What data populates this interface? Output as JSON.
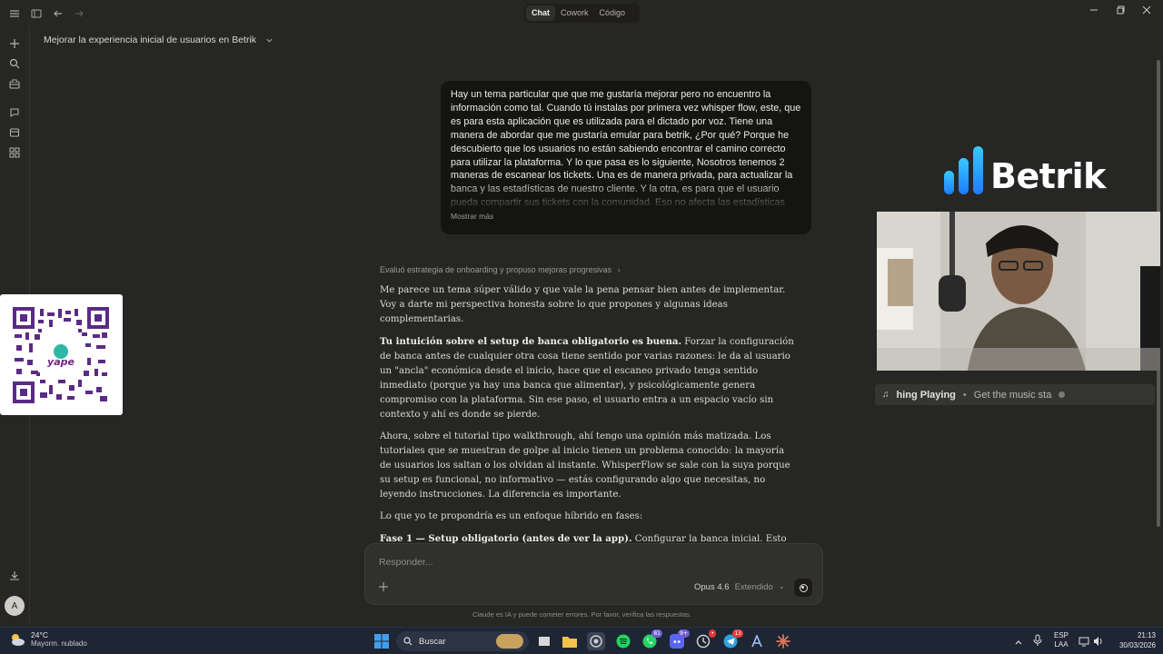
{
  "titlebar": {
    "modes": [
      "Chat",
      "Cowork",
      "Código"
    ],
    "active_mode": "Chat"
  },
  "conversation": {
    "title": "Mejorar la experiencia inicial de usuarios en Betrik"
  },
  "user_message": {
    "text": "Hay un tema particular que que me gustaría mejorar pero no encuentro la información como tal. Cuando tú instalas por primera vez whisper flow, este, que es para esta aplicación que es utilizada para el dictado por voz. Tiene una manera de abordar que me gustaría emular para betrik, ¿Por qué? Porque he descubierto que los usuarios no están sabiendo encontrar el camino correcto para utilizar la plataforma. Y lo que pasa es lo siguiente, Nosotros tenemos 2 maneras de escanear los tickets. Una es de manera privada, para actualizar la banca y las estadísticas de nuestro cliente. Y la otra, es para que el usuario pueda compartir sus tickets con la comunidad. Eso no afecta las estadísticas",
    "show_more": "Mostrar más"
  },
  "assistant": {
    "thinking_summary": "Evaluó estrategia de onboarding y propuso mejoras progresivas",
    "p1": "Me parece un tema súper válido y que vale la pena pensar bien antes de implementar. Voy a darte mi perspectiva honesta sobre lo que propones y algunas ideas complementarias.",
    "p2_bold": "Tu intuición sobre el setup de banca obligatorio es buena.",
    "p2_rest": " Forzar la configuración de banca antes de cualquier otra cosa tiene sentido por varias razones: le da al usuario un \"ancla\" económica desde el inicio, hace que el escaneo privado tenga sentido inmediato (porque ya hay una banca que alimentar), y psicológicamente genera compromiso con la plataforma. Sin ese paso, el usuario entra a un espacio vacío sin contexto y ahí es donde se pierde.",
    "p3": "Ahora, sobre el tutorial tipo walkthrough, ahí tengo una opinión más matizada. Los tutoriales que se muestran de golpe al inicio tienen un problema conocido: la mayoría de usuarios los saltan o los olvidan al instante. WhisperFlow se sale con la suya porque su setup es funcional, no informativo — estás configurando algo que necesitas, no leyendo instrucciones. La diferencia es importante.",
    "p4": "Lo que yo te propondría es un enfoque híbrido en fases:",
    "p5_bold": "Fase 1 — Setup obligatorio (antes de ver la app).",
    "p5_rest": " Configurar la banca inicial. Esto sí es al estilo WhisperFlow: no puedes avanzar sin hacerlo. Puede ser una o dos pantallas simples: monto inicial, quizás la casa de apuestas principal. Rápido, funcional, sin texto innecesario."
  },
  "composer": {
    "placeholder": "Responder...",
    "model": "Opus 4.6",
    "mode": "Extendido"
  },
  "disclaimer": "Claude es IA y puede cometer errores. Por favor, verifica las respuestas.",
  "overlay": {
    "qr_label": "yape",
    "brand_name": "Betrik",
    "music_now_playing": "hing Playing",
    "music_track": "Get the music sta"
  },
  "taskbar": {
    "temperature": "24°C",
    "weather": "Mayorm. nublado",
    "search_label": "Buscar",
    "lang_line1": "ESP",
    "lang_line2": "LAA",
    "time": "21:13",
    "date": "30/03/2026",
    "badges": {
      "whatsapp": "81",
      "discord": "9+",
      "telegram": "13"
    }
  }
}
